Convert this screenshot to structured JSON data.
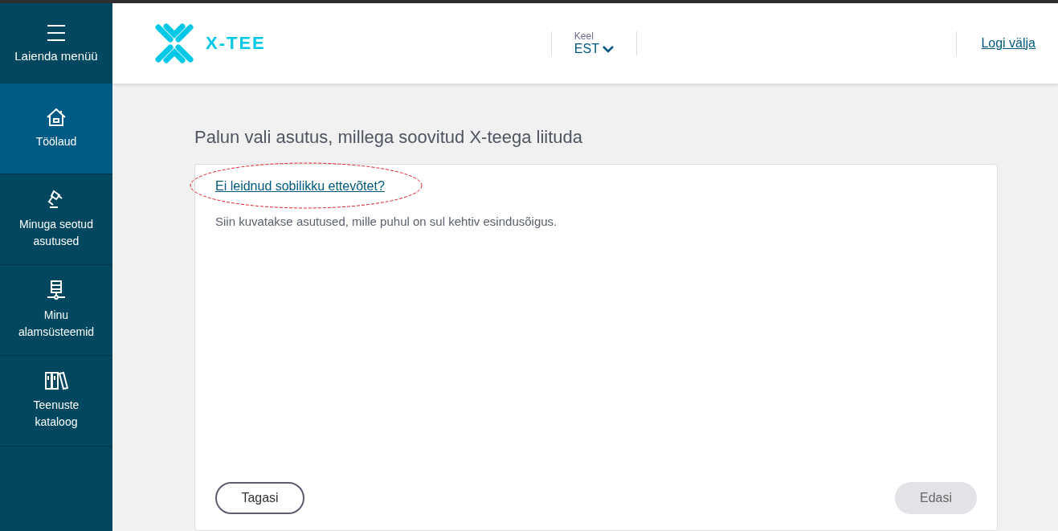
{
  "sidebar": {
    "toggle": {
      "label": "Laienda menüü"
    },
    "items": [
      {
        "label": "Töölaud",
        "selected": true
      },
      {
        "label": "Minuga seotud asutused",
        "selected": false
      },
      {
        "label": "Minu alamsüsteemid",
        "selected": false
      },
      {
        "label": "Teenuste kataloog",
        "selected": false
      }
    ]
  },
  "header": {
    "logo": "X-TEE",
    "language": {
      "label": "Keel",
      "value": "EST"
    },
    "logout": "Logi välja"
  },
  "main": {
    "title": "Palun vali asutus, millega soovitud X-teega liituda",
    "link": "Ei leidnud sobilikku ettevõtet?",
    "link_highlighted": true,
    "description": "Siin kuvatakse asutused, mille puhul on sul kehtiv esindusõigus.",
    "buttons": [
      {
        "label": "Tagasi",
        "kind": "outline",
        "disabled": false
      },
      {
        "label": "Edasi",
        "kind": "filled",
        "disabled": true
      }
    ]
  }
}
